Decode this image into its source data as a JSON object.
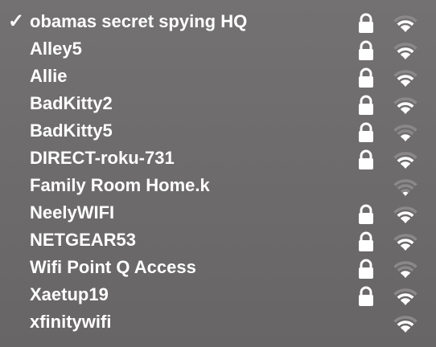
{
  "networks": [
    {
      "name": "obamas secret spying HQ",
      "connected": true,
      "secured": true,
      "signal_bars": 3
    },
    {
      "name": "Alley5",
      "connected": false,
      "secured": true,
      "signal_bars": 3
    },
    {
      "name": "Allie",
      "connected": false,
      "secured": true,
      "signal_bars": 3
    },
    {
      "name": "BadKitty2",
      "connected": false,
      "secured": true,
      "signal_bars": 3
    },
    {
      "name": "BadKitty5",
      "connected": false,
      "secured": true,
      "signal_bars": 2
    },
    {
      "name": "DIRECT-roku-731",
      "connected": false,
      "secured": true,
      "signal_bars": 3
    },
    {
      "name": "Family Room Home.k",
      "connected": false,
      "secured": false,
      "signal_bars": 1
    },
    {
      "name": "NeelyWIFI",
      "connected": false,
      "secured": true,
      "signal_bars": 3
    },
    {
      "name": "NETGEAR53",
      "connected": false,
      "secured": true,
      "signal_bars": 3
    },
    {
      "name": "Wifi Point Q Access",
      "connected": false,
      "secured": true,
      "signal_bars": 2
    },
    {
      "name": "Xaetup19",
      "connected": false,
      "secured": true,
      "signal_bars": 3
    },
    {
      "name": "xfinitywifi",
      "connected": false,
      "secured": false,
      "signal_bars": 3
    }
  ],
  "connected_mark": "✓",
  "icons": {
    "lock": "lock-icon",
    "wifi": "wifi-signal-icon"
  },
  "colors": {
    "text": "#ffffff",
    "icon_active": "#ffffff",
    "icon_dim": "#8a8888",
    "background": "#6f6d6d"
  }
}
